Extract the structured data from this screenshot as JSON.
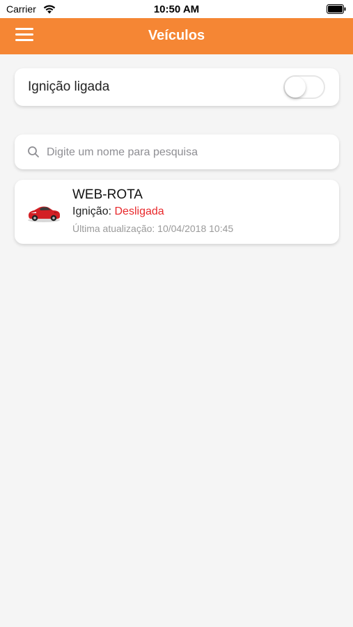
{
  "status_bar": {
    "carrier": "Carrier",
    "time": "10:50 AM",
    "wifi_icon": "wifi-icon",
    "battery_icon": "battery-icon"
  },
  "navbar": {
    "title": "Veículos",
    "menu_icon": "hamburger-menu-icon",
    "background_color": "#f58634"
  },
  "ignition_filter": {
    "label": "Ignição ligada",
    "toggle_on": false
  },
  "search": {
    "placeholder": "Digite um nome para pesquisa",
    "value": "",
    "icon": "search-icon"
  },
  "vehicles": [
    {
      "name": "WEB-ROTA",
      "ignition_label": "Ignição:",
      "ignition_status": "Desligada",
      "ignition_status_color": "#e8282b",
      "last_update": "Última atualização: 10/04/2018 10:45",
      "icon": "red-car-icon"
    }
  ]
}
